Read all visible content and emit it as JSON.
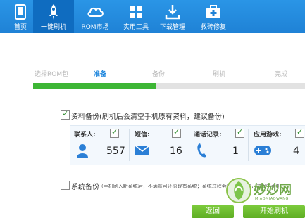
{
  "nav": [
    {
      "label": "首页",
      "icon": "home-icon"
    },
    {
      "label": "一键刷机",
      "icon": "rocket-icon"
    },
    {
      "label": "ROM市场",
      "icon": "cloud-icon"
    },
    {
      "label": "实用工具",
      "icon": "grid-icon"
    },
    {
      "label": "下载管理",
      "icon": "download-icon"
    },
    {
      "label": "救砖修复",
      "icon": "medkit-icon"
    }
  ],
  "steps": [
    "选择ROM包",
    "准备",
    "备份",
    "刷机",
    "完成"
  ],
  "current_step": "准备",
  "progress": 0.45,
  "backup": {
    "title": "资料备份",
    "note": "(刷机后会清空手机原有资料，建议备份)",
    "items": [
      {
        "label": "联系人:",
        "count": "557",
        "icon": "person-icon"
      },
      {
        "label": "短信:",
        "count": "16",
        "icon": "envelope-icon"
      },
      {
        "label": "通话记录:",
        "count": "1",
        "icon": "phone-icon"
      },
      {
        "label": "应用游戏:",
        "count": "4",
        "icon": "gamepad-icon"
      }
    ]
  },
  "system_backup": {
    "title": "系统备份",
    "note": "(手机刷入新系统后，不满意可还原现有系统；系统过程会耗时数分钟，过程中手机"
  },
  "buttons": {
    "back": "返回",
    "start": "开始刷机"
  },
  "watermark": {
    "text": "妙妙网",
    "sub": "MIAOMIAOWANG"
  },
  "colors": {
    "nav_bg": "#1f82d6",
    "accent": "#1e86dd",
    "progress": "#3db635",
    "button": "#5fae24"
  }
}
